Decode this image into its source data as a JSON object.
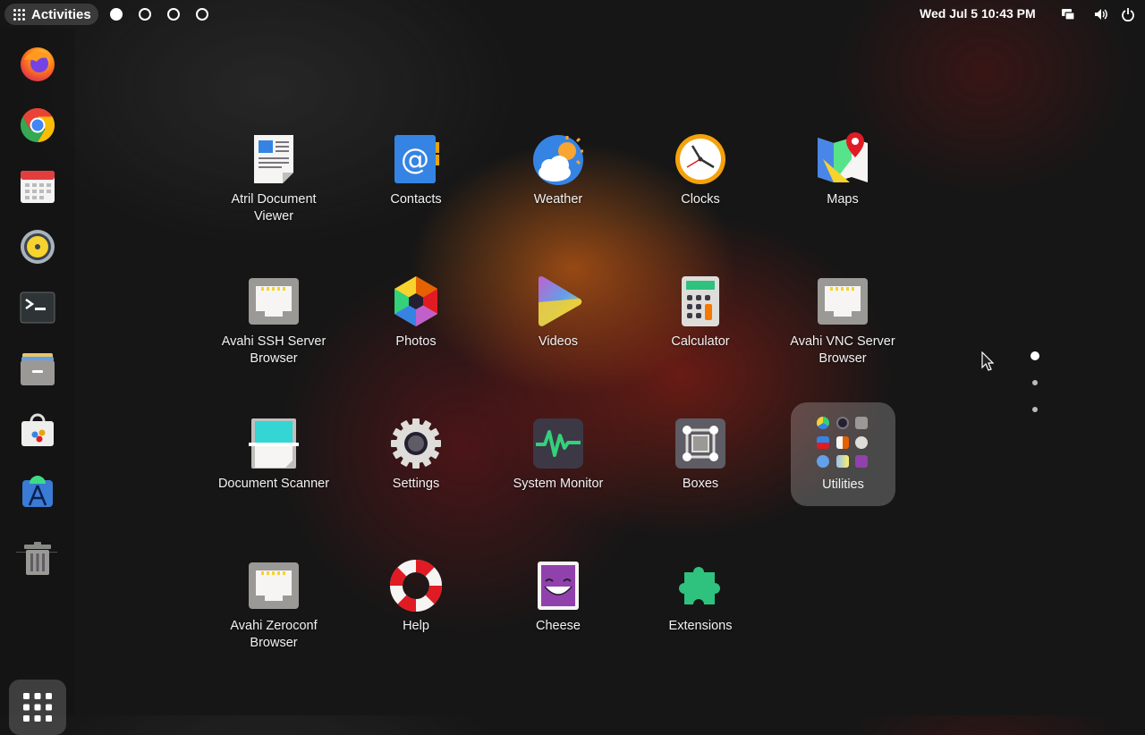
{
  "topbar": {
    "activities_label": "Activities",
    "clock": "Wed Jul 5  10:43 PM",
    "workspaces": [
      {
        "active": true
      },
      {
        "active": false
      },
      {
        "active": false
      },
      {
        "active": false
      }
    ],
    "status_icons": [
      "network-icon",
      "volume-icon",
      "power-icon"
    ]
  },
  "dock": {
    "apps": [
      {
        "name": "Firefox",
        "icon": "firefox-icon"
      },
      {
        "name": "Chrome",
        "icon": "chrome-icon"
      },
      {
        "name": "Calendar",
        "icon": "calendar-icon"
      },
      {
        "name": "Rhythmbox",
        "icon": "speaker-icon"
      },
      {
        "name": "Terminal",
        "icon": "terminal-icon"
      },
      {
        "name": "Files",
        "icon": "files-icon"
      },
      {
        "name": "Software",
        "icon": "software-icon"
      },
      {
        "name": "Android Studio",
        "icon": "android-studio-icon"
      }
    ],
    "trash_icon": "trash-icon",
    "show_apps_icon": "show-apps-grid-icon"
  },
  "grid": {
    "apps": [
      {
        "label": "Atril Document Viewer",
        "icon": "document-viewer-icon"
      },
      {
        "label": "Contacts",
        "icon": "contacts-icon"
      },
      {
        "label": "Weather",
        "icon": "weather-icon"
      },
      {
        "label": "Clocks",
        "icon": "clock-icon"
      },
      {
        "label": "Maps",
        "icon": "maps-icon"
      },
      {
        "label": "Avahi SSH Server Browser",
        "icon": "network-port-icon"
      },
      {
        "label": "Photos",
        "icon": "photos-icon"
      },
      {
        "label": "Videos",
        "icon": "videos-icon"
      },
      {
        "label": "Calculator",
        "icon": "calculator-icon"
      },
      {
        "label": "Avahi VNC Server Browser",
        "icon": "network-port-icon"
      },
      {
        "label": "Document Scanner",
        "icon": "scanner-icon"
      },
      {
        "label": "Settings",
        "icon": "settings-gear-icon"
      },
      {
        "label": "System Monitor",
        "icon": "system-monitor-icon"
      },
      {
        "label": "Boxes",
        "icon": "boxes-icon"
      },
      {
        "label": "Utilities",
        "icon": "folder-icon"
      },
      {
        "label": "Avahi Zeroconf Browser",
        "icon": "network-port-icon"
      },
      {
        "label": "Help",
        "icon": "help-lifebuoy-icon"
      },
      {
        "label": "Cheese",
        "icon": "cheese-icon"
      },
      {
        "label": "Extensions",
        "icon": "extensions-puzzle-icon"
      }
    ]
  },
  "pagination": {
    "pages": 3,
    "current": 1
  }
}
